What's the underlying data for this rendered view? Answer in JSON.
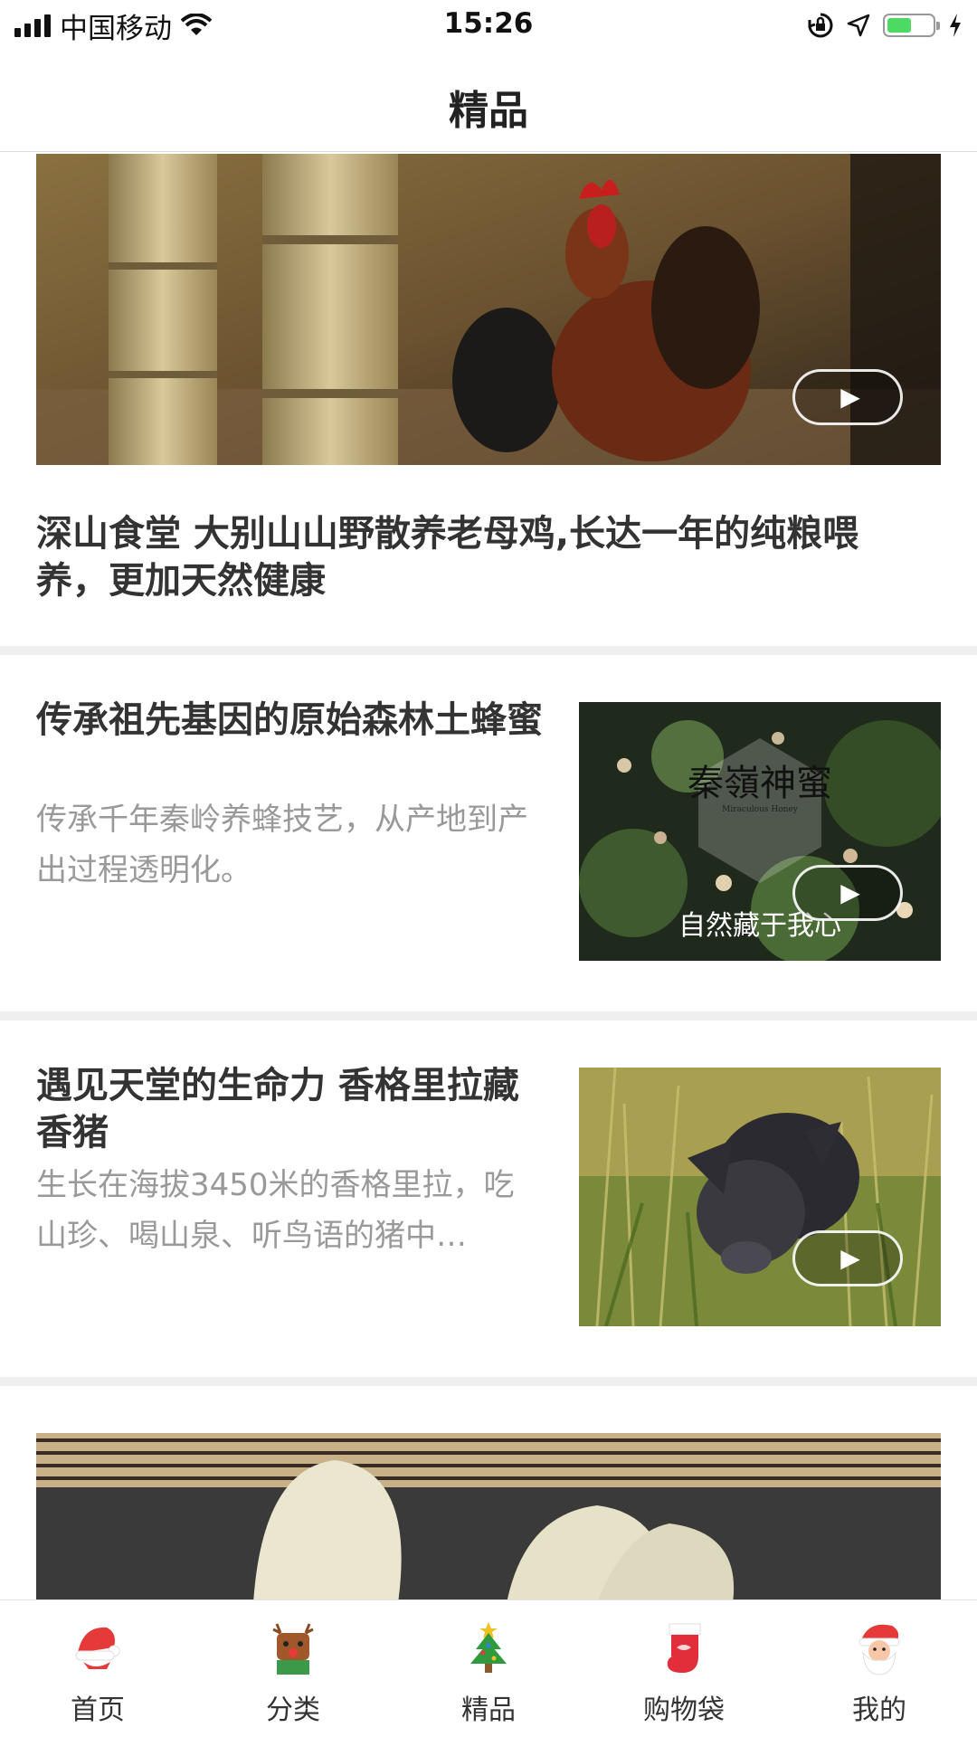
{
  "status_bar": {
    "carrier": "中国移动",
    "time": "15:26",
    "battery_level": 0.55,
    "icons": [
      "signal-icon",
      "wifi-icon",
      "orientation-lock-icon",
      "location-icon",
      "battery-icon",
      "charging-icon"
    ]
  },
  "nav": {
    "title": "精品"
  },
  "feed": {
    "hero": {
      "title": "深山食堂 大别山山野散养老母鸡,长达一年的纯粮喂养，更加天然健康",
      "image_icon": "rooster-photo"
    },
    "items": [
      {
        "title": "传承祖先基因的原始森林土蜂蜜",
        "desc": "传承千年秦岭养蜂技艺，从产地到产出过程透明化。",
        "image_icon": "honey-pine-photo",
        "image_logo": "秦嶺神蜜",
        "image_logo_sub": "Miraculous Honey",
        "image_caption": "自然藏于我心"
      },
      {
        "title": "遇见天堂的生命力 香格里拉藏香猪",
        "desc": "生长在海拔3450米的香格里拉，吃山珍、喝山泉、听鸟语的猪中…",
        "image_icon": "black-pig-photo"
      }
    ],
    "partial": {
      "image_icon": "mushroom-dish-photo"
    }
  },
  "tabbar": {
    "tabs": [
      {
        "label": "首页",
        "icon": "santa-hat-icon"
      },
      {
        "label": "分类",
        "icon": "reindeer-icon"
      },
      {
        "label": "精品",
        "icon": "christmas-tree-icon"
      },
      {
        "label": "购物袋",
        "icon": "christmas-stocking-icon"
      },
      {
        "label": "我的",
        "icon": "santa-face-icon"
      }
    ]
  },
  "colors": {
    "divider": "#efefef",
    "title_text": "#333333",
    "desc_text": "#999999",
    "battery": "#4cd964"
  }
}
